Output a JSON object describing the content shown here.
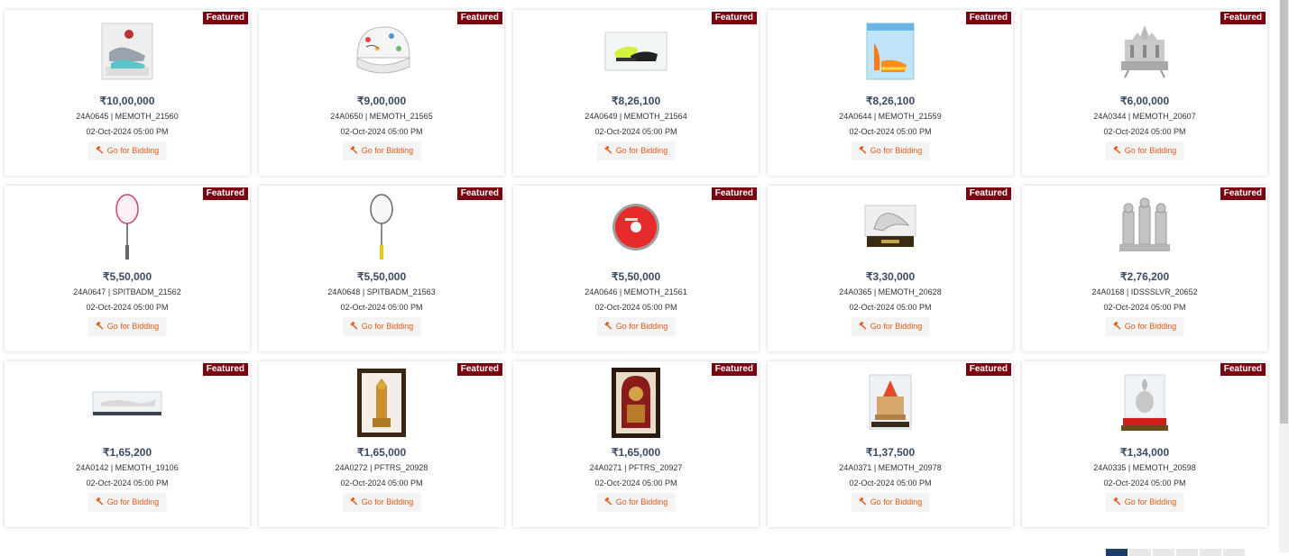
{
  "badge_label": "Featured",
  "bid_label": "Go for Bidding",
  "colors": {
    "badge": "#7a0010",
    "price": "#3b4a63",
    "bid_text": "#e05a1a",
    "pager_active": "#1f3b6a"
  },
  "items": [
    {
      "price": "₹10,00,000",
      "code": "24A0645 | MEMOTH_21560",
      "date": "02-Oct-2024 05:00 PM",
      "image": "shoe-display-icon"
    },
    {
      "price": "₹9,00,000",
      "code": "24A0650 | MEMOTH_21565",
      "date": "02-Oct-2024 05:00 PM",
      "image": "signed-cap-icon"
    },
    {
      "price": "₹8,26,100",
      "code": "24A0649 | MEMOTH_21564",
      "date": "02-Oct-2024 05:00 PM",
      "image": "spike-shoes-box-icon"
    },
    {
      "price": "₹8,26,100",
      "code": "24A0644 | MEMOTH_21559",
      "date": "02-Oct-2024 05:00 PM",
      "image": "orange-shoes-box-icon"
    },
    {
      "price": "₹6,00,000",
      "code": "24A0344 | MEMOTH_20607",
      "date": "02-Oct-2024 05:00 PM",
      "image": "temple-model-icon"
    },
    {
      "price": "₹5,50,000",
      "code": "24A0647 | SPITBADM_21562",
      "date": "02-Oct-2024 05:00 PM",
      "image": "racket-pink-icon"
    },
    {
      "price": "₹5,50,000",
      "code": "24A0648 | SPITBADM_21563",
      "date": "02-Oct-2024 05:00 PM",
      "image": "racket-yellow-icon"
    },
    {
      "price": "₹5,50,000",
      "code": "24A0646 | MEMOTH_21561",
      "date": "02-Oct-2024 05:00 PM",
      "image": "discus-icon"
    },
    {
      "price": "₹3,30,000",
      "code": "24A0365 | MEMOTH_20628",
      "date": "02-Oct-2024 05:00 PM",
      "image": "peacock-model-icon"
    },
    {
      "price": "₹2,76,200",
      "code": "24A0168 | IDSSSLVR_20652",
      "date": "02-Oct-2024 05:00 PM",
      "image": "silver-idols-icon"
    },
    {
      "price": "₹1,65,200",
      "code": "24A0142 | MEMOTH_19106",
      "date": "02-Oct-2024 05:00 PM",
      "image": "boat-model-icon"
    },
    {
      "price": "₹1,65,000",
      "code": "24A0272 | PFTRS_20928",
      "date": "02-Oct-2024 05:00 PM",
      "image": "framed-deity-icon"
    },
    {
      "price": "₹1,65,000",
      "code": "24A0271 | PFTRS_20927",
      "date": "02-Oct-2024 05:00 PM",
      "image": "framed-painting-icon"
    },
    {
      "price": "₹1,37,500",
      "code": "24A0371 | MEMOTH_20978",
      "date": "02-Oct-2024 05:00 PM",
      "image": "temple-box-icon"
    },
    {
      "price": "₹1,34,000",
      "code": "24A0335 | MEMOTH_20598",
      "date": "02-Oct-2024 05:00 PM",
      "image": "kalash-box-icon"
    }
  ]
}
